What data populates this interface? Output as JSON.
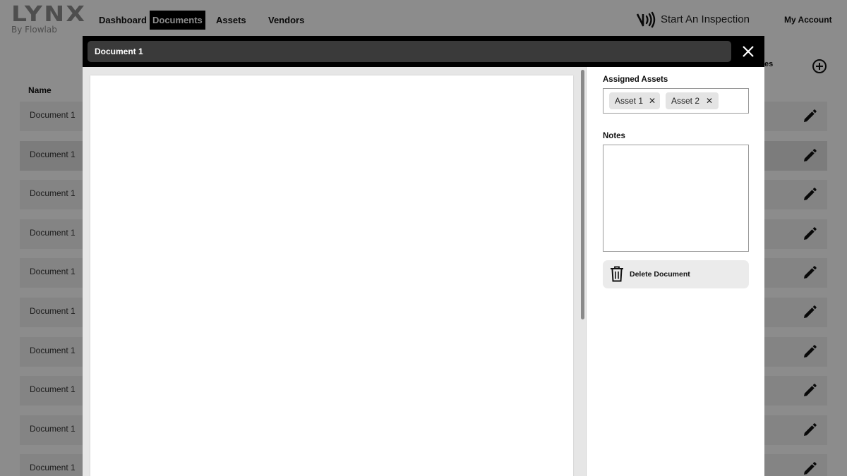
{
  "app": {
    "logo": {
      "word": "LYNX",
      "sub": "By Flowlab"
    },
    "nav": [
      {
        "label": "Dashboard",
        "active": false
      },
      {
        "label": "Documents",
        "active": true
      },
      {
        "label": "Assets",
        "active": false
      },
      {
        "label": "Vendors",
        "active": false
      }
    ],
    "start_inspection": "Start An Inspection",
    "my_account": "My Account"
  },
  "list": {
    "name_header": "Name",
    "partial_header": "es",
    "rows": [
      "Document 1",
      "Document 1",
      "Document 1",
      "Document 1",
      "Document 1",
      "Document 1",
      "Document 1",
      "Document 1",
      "Document 1",
      "Document 1"
    ]
  },
  "modal": {
    "title": "Document 1",
    "assigned_assets_label": "Assigned Assets",
    "assets": [
      "Asset 1",
      "Asset 2"
    ],
    "notes_label": "Notes",
    "notes_value": "",
    "delete_label": "Delete Document"
  },
  "colors": {
    "accent": "#000000",
    "title_bar": "#3a3a3a",
    "row_bg": "#f0f0f0",
    "row_bg_alt": "#e2e2e2",
    "logo": "#8e8e8e"
  },
  "icons": [
    "nfc-icon",
    "plus-circle-icon",
    "edit-pencil-icon",
    "close-icon",
    "trash-icon"
  ]
}
